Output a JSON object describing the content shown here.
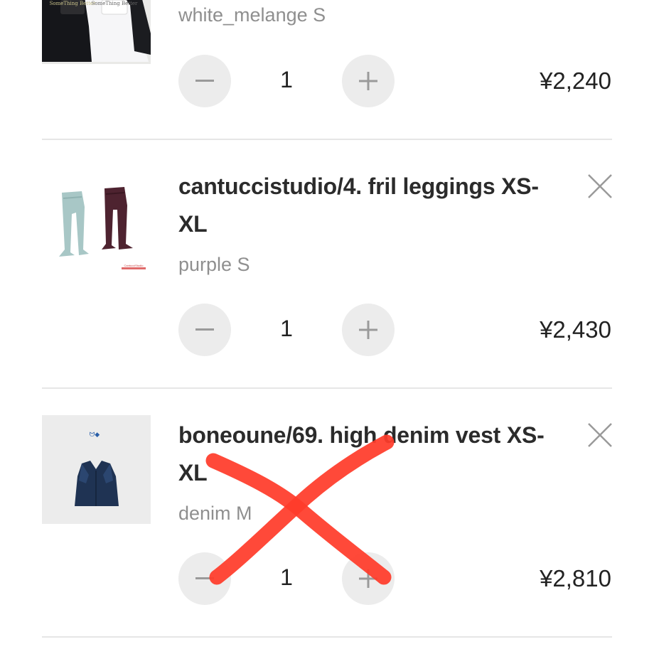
{
  "cart": {
    "items": [
      {
        "title": "",
        "variant": "white_melange S",
        "quantity": "1",
        "price": "¥2,240"
      },
      {
        "title": "cantuccistudio/4. fril leggings XS-XL",
        "variant": "purple S",
        "quantity": "1",
        "price": "¥2,430"
      },
      {
        "title": "boneoune/69. high denim vest XS-XL",
        "variant": "denim M",
        "quantity": "1",
        "price": "¥2,810"
      }
    ],
    "thumbnail_text": {
      "item1_print": "SomeThing Better",
      "item2_brand": "CantucciStudio"
    }
  },
  "icons": {
    "remove": "close-icon",
    "decrease": "minus-icon",
    "increase": "plus-icon"
  },
  "colors": {
    "button_bg": "#ececec",
    "variant_text": "#8f8f8f",
    "annotation_red": "#ff3b2a",
    "divider": "#e6e6e6"
  }
}
